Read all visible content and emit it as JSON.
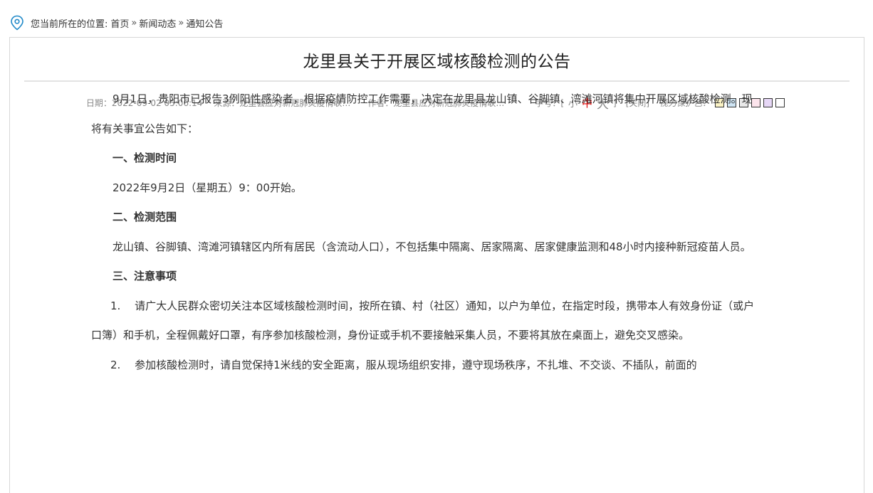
{
  "breadcrumb": {
    "prefix": "您当前所在的位置:",
    "items": [
      "首页",
      "新闻动态",
      "通知公告"
    ],
    "separator": "»"
  },
  "article": {
    "title": "龙里县关于开展区域核酸检测的公告",
    "meta": {
      "date": "日期：2022-09-02 05:06:14",
      "source": "来源：龙里县应对新冠肺炎疫情联防...",
      "author": "作者：龙里县应对新冠肺炎疫情联防...",
      "font_label": "字号：[",
      "font_small": "小",
      "font_mid": "中",
      "font_big": "大",
      "font_close_bracket": "]",
      "close": "[关闭]",
      "eye_label": "视力保护色：",
      "eye_colors": [
        "#fbf3c5",
        "#cfe5f4",
        "#e9e9e9",
        "#fce4ec",
        "#e6d7f6",
        "#ffffff"
      ]
    },
    "paragraphs": [
      "9月1日，贵阳市已报告3例阳性感染者，根据疫情防控工作需要，决定在龙里县龙山镇、谷脚镇、湾滩河镇将集中开展区域核酸检测。现将有关事宜公告如下：",
      "一、检测时间",
      "2022年9月2日（星期五）9：00开始。",
      "二、检测范围",
      "龙山镇、谷脚镇、湾滩河镇辖区内所有居民（含流动人口），不包括集中隔离、居家隔离、居家健康监测和48小时内接种新冠疫苗人员。",
      "三、注意事项",
      "1.　 请广大人民群众密切关注本区域核酸检测时间，按所在镇、村（社区）通知，以户为单位，在指定时段，携带本人有效身份证（或户口簿）和手机，全程佩戴好口罩，有序参加核酸检测，身份证或手机不要接触采集人员，不要将其放在桌面上，避免交叉感染。",
      "2.　 参加核酸检测时，请自觉保持1米线的安全距离，服从现场组织安排，遵守现场秩序，不扎堆、不交谈、不插队，前面的"
    ]
  }
}
